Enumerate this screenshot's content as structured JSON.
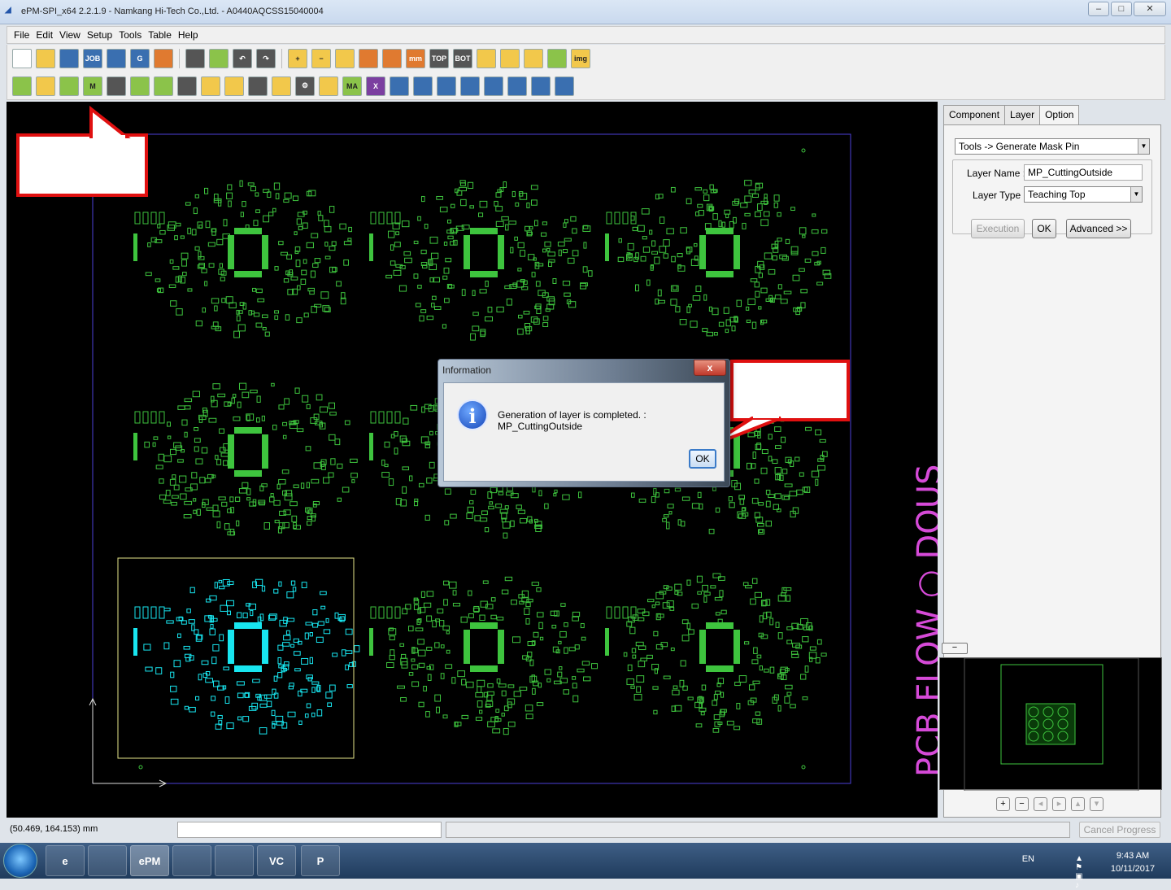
{
  "window": {
    "title": "ePM-SPI_x64 2.2.1.9 - Namkang Hi-Tech Co.,Ltd. - A0440AQCSS15040004",
    "app_icon": "epm-app-icon",
    "controls": {
      "minimize": "‒",
      "maximize": "□",
      "close": "✕"
    }
  },
  "menu": {
    "items": [
      "File",
      "Edit",
      "View",
      "Setup",
      "Tools",
      "Table",
      "Help"
    ]
  },
  "toolbar1": {
    "buttons": [
      {
        "icon": "new-file-icon",
        "glyph": "",
        "style": "w"
      },
      {
        "icon": "open-folder-icon",
        "glyph": "",
        "style": "y"
      },
      {
        "icon": "save-icon",
        "glyph": "",
        "style": ""
      },
      {
        "icon": "job-icon",
        "glyph": "JOB",
        "style": ""
      },
      {
        "icon": "export-icon",
        "glyph": "",
        "style": ""
      },
      {
        "icon": "gerber-icon",
        "glyph": "G",
        "style": ""
      },
      {
        "icon": "import-icon",
        "glyph": "",
        "style": "r"
      },
      {
        "icon": "sep",
        "glyph": "",
        "style": ""
      },
      {
        "icon": "grid-disabled-icon",
        "glyph": "",
        "style": "k"
      },
      {
        "icon": "layer-edit-icon",
        "glyph": "",
        "style": "g"
      },
      {
        "icon": "undo-icon",
        "glyph": "↶",
        "style": "k"
      },
      {
        "icon": "redo-icon",
        "glyph": "↷",
        "style": "k"
      },
      {
        "icon": "sep",
        "glyph": "",
        "style": ""
      },
      {
        "icon": "zoom-in-icon",
        "glyph": "+",
        "style": "y"
      },
      {
        "icon": "zoom-out-icon",
        "glyph": "−",
        "style": "y"
      },
      {
        "icon": "zoom-fit-icon",
        "glyph": "",
        "style": "y"
      },
      {
        "icon": "zoom-window-icon",
        "glyph": "",
        "style": "r"
      },
      {
        "icon": "pan-icon",
        "glyph": "",
        "style": "r"
      },
      {
        "icon": "measure-icon",
        "glyph": "mm",
        "style": "r"
      },
      {
        "icon": "top-icon",
        "glyph": "TOP",
        "style": "k"
      },
      {
        "icon": "bottom-icon",
        "glyph": "BOT",
        "style": "k"
      },
      {
        "icon": "rotate-icon",
        "glyph": "",
        "style": "y"
      },
      {
        "icon": "highlight-icon",
        "glyph": "",
        "style": "y"
      },
      {
        "icon": "light-icon",
        "glyph": "",
        "style": "y"
      },
      {
        "icon": "align-icon",
        "glyph": "",
        "style": "g"
      },
      {
        "icon": "image-icon",
        "glyph": "img",
        "style": "y"
      }
    ]
  },
  "toolbar2": {
    "buttons": [
      {
        "icon": "pen-icon",
        "glyph": "",
        "style": "g"
      },
      {
        "icon": "cut-icon",
        "glyph": "",
        "style": "y"
      },
      {
        "icon": "pad-icon",
        "glyph": "",
        "style": "g"
      },
      {
        "icon": "mask-icon",
        "glyph": "M",
        "style": "g"
      },
      {
        "icon": "chip-disabled-icon",
        "glyph": "",
        "style": "k"
      },
      {
        "icon": "component-icon",
        "glyph": "",
        "style": "g"
      },
      {
        "icon": "component-edit-icon",
        "glyph": "",
        "style": "g"
      },
      {
        "icon": "hand-icon",
        "glyph": "",
        "style": "k"
      },
      {
        "icon": "select-icon",
        "glyph": "",
        "style": "y"
      },
      {
        "icon": "polygon-icon",
        "glyph": "",
        "style": "y"
      },
      {
        "icon": "panel-grid-icon",
        "glyph": "",
        "style": "k"
      },
      {
        "icon": "move-icon",
        "glyph": "",
        "style": "y"
      },
      {
        "icon": "gear-icon",
        "glyph": "⚙",
        "style": "k"
      },
      {
        "icon": "fiducial-icon",
        "glyph": "",
        "style": "y"
      },
      {
        "icon": "auto-mark-icon",
        "glyph": "MA",
        "style": "g"
      },
      {
        "icon": "delete-icon",
        "glyph": "X",
        "style": "p"
      },
      {
        "icon": "pad-link-icon",
        "glyph": "",
        "style": ""
      },
      {
        "icon": "pad-rotate-icon",
        "glyph": "",
        "style": ""
      },
      {
        "icon": "array-icon",
        "glyph": "",
        "style": ""
      },
      {
        "icon": "mirror-icon",
        "glyph": "",
        "style": ""
      },
      {
        "icon": "array-step-icon",
        "glyph": "",
        "style": ""
      },
      {
        "icon": "grid-step-icon",
        "glyph": "",
        "style": ""
      },
      {
        "icon": "table-icon",
        "glyph": "",
        "style": ""
      },
      {
        "icon": "flip-icon",
        "glyph": "",
        "style": ""
      }
    ]
  },
  "right_panel": {
    "tabs": [
      "Component",
      "Layer",
      "Option"
    ],
    "active_tab": "Option",
    "function_select": "Tools -> Generate Mask Pin",
    "layer_name_label": "Layer Name :",
    "layer_name_value": "MP_CuttingOutside",
    "layer_type_label": "Layer Type :",
    "layer_type_value": "Teaching Top",
    "execution_label": "Execution",
    "ok_label": "OK",
    "advanced_label": "Advanced >>",
    "collapse_label": "−"
  },
  "canvas": {
    "side_text": "PCB FLOW  ○ DOUS",
    "colors": {
      "pads": "#3ec43e",
      "selected": "#18e6f0",
      "outline": "#4b3fd8",
      "selection_box": "#e6e68a",
      "annotation": "#d64ad8"
    }
  },
  "minimap_controls": [
    "+",
    "−",
    "◂",
    "▸",
    "▴",
    "▾"
  ],
  "statusbar": {
    "coordinates": "(50.469, 164.153) mm",
    "cancel_label": "Cancel Progress"
  },
  "dialog": {
    "title": "Information",
    "close_label": "x",
    "icon": "info-icon",
    "message": "Generation of layer is completed. : MP_CuttingOutside",
    "ok_label": "OK"
  },
  "taskbar": {
    "apps": [
      {
        "icon": "ie-icon",
        "label": "e"
      },
      {
        "icon": "explorer-folder-icon",
        "label": ""
      },
      {
        "icon": "epm-task-icon",
        "label": "ePM"
      },
      {
        "icon": "window-task-icon",
        "label": ""
      },
      {
        "icon": "app-task-icon",
        "label": ""
      },
      {
        "icon": "vc-task-icon",
        "label": "VC"
      },
      {
        "icon": "powerpoint-icon",
        "label": "P"
      }
    ],
    "lang": "EN",
    "time": "9:43 AM",
    "date": "10/11/2017"
  },
  "accent_colors": {
    "callout_border": "#e01010",
    "titlebar": "#c9d9ee"
  }
}
